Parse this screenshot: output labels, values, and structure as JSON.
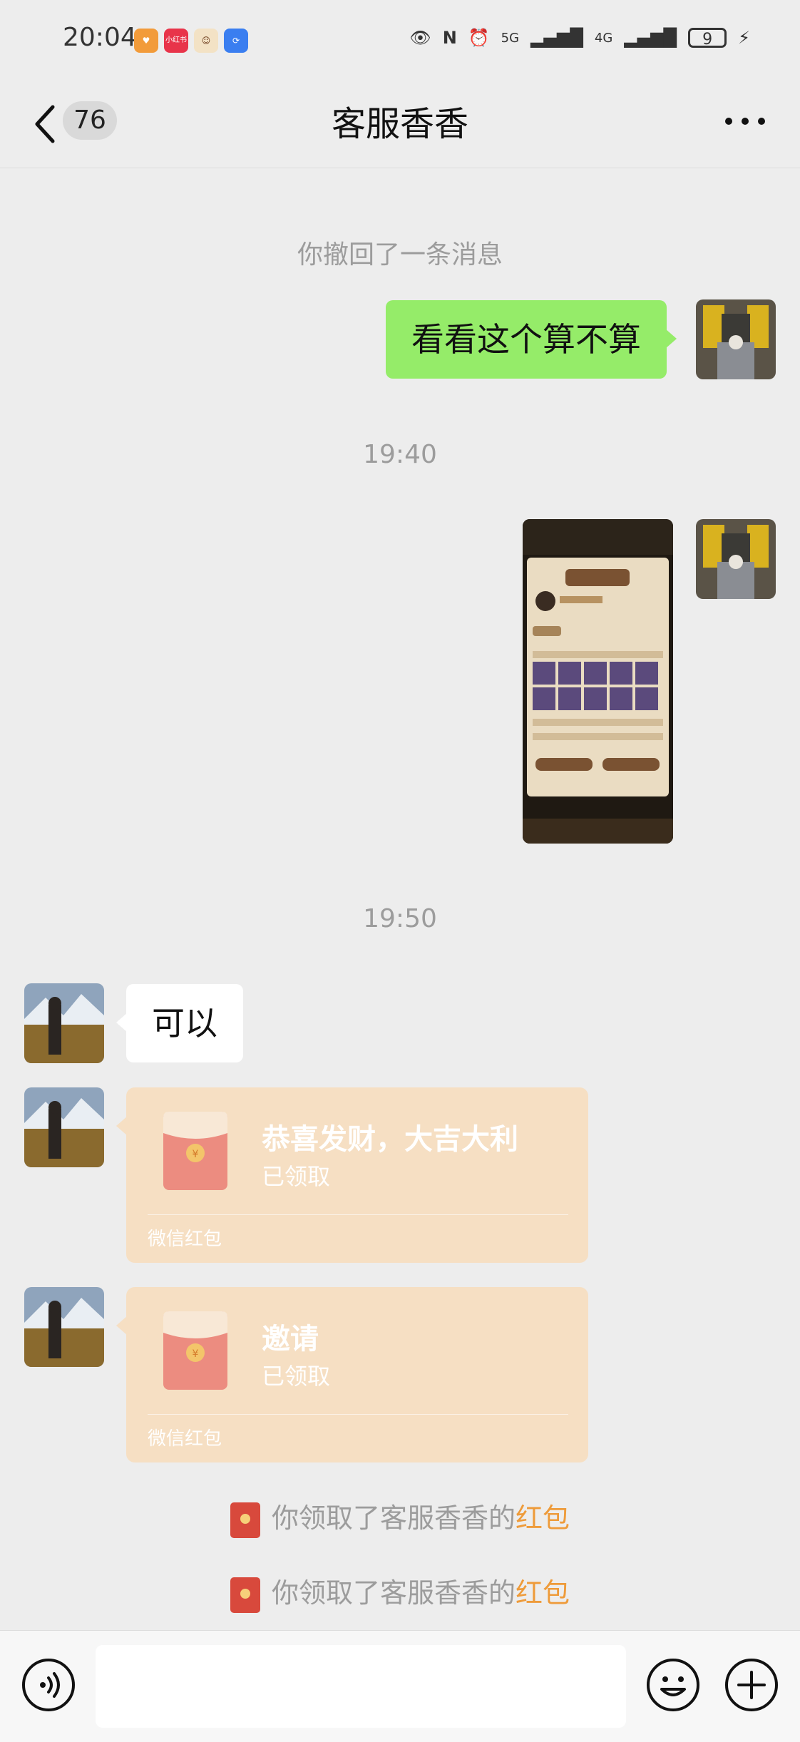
{
  "status_bar": {
    "time": "20:04",
    "apps": [
      "love-app-icon",
      "xiaohongshu-icon",
      "monkey-app-icon",
      "blue-app-icon"
    ],
    "xiaohongshu_label": "小红书",
    "signal_5g": "5G",
    "signal_4g": "4G",
    "battery": "9"
  },
  "header": {
    "unread_count": "76",
    "title": "客服香香"
  },
  "chat": {
    "recall_notice": "你撤回了一条消息",
    "msg1": "看看这个算不算",
    "time1": "19:40",
    "time2": "19:50",
    "reply": "可以",
    "redpacket1": {
      "title": "恭喜发财，大吉大利",
      "status": "已领取",
      "footer": "微信红包"
    },
    "redpacket2": {
      "title": "邀请",
      "status": "已领取",
      "footer": "微信红包"
    },
    "claim_text": "你领取了客服香香的",
    "claim_link": "红包"
  },
  "colors": {
    "background": "#ededed",
    "my_bubble": "#95ec69",
    "redpacket": "#f6dfc3",
    "link": "#ee9b3a"
  }
}
